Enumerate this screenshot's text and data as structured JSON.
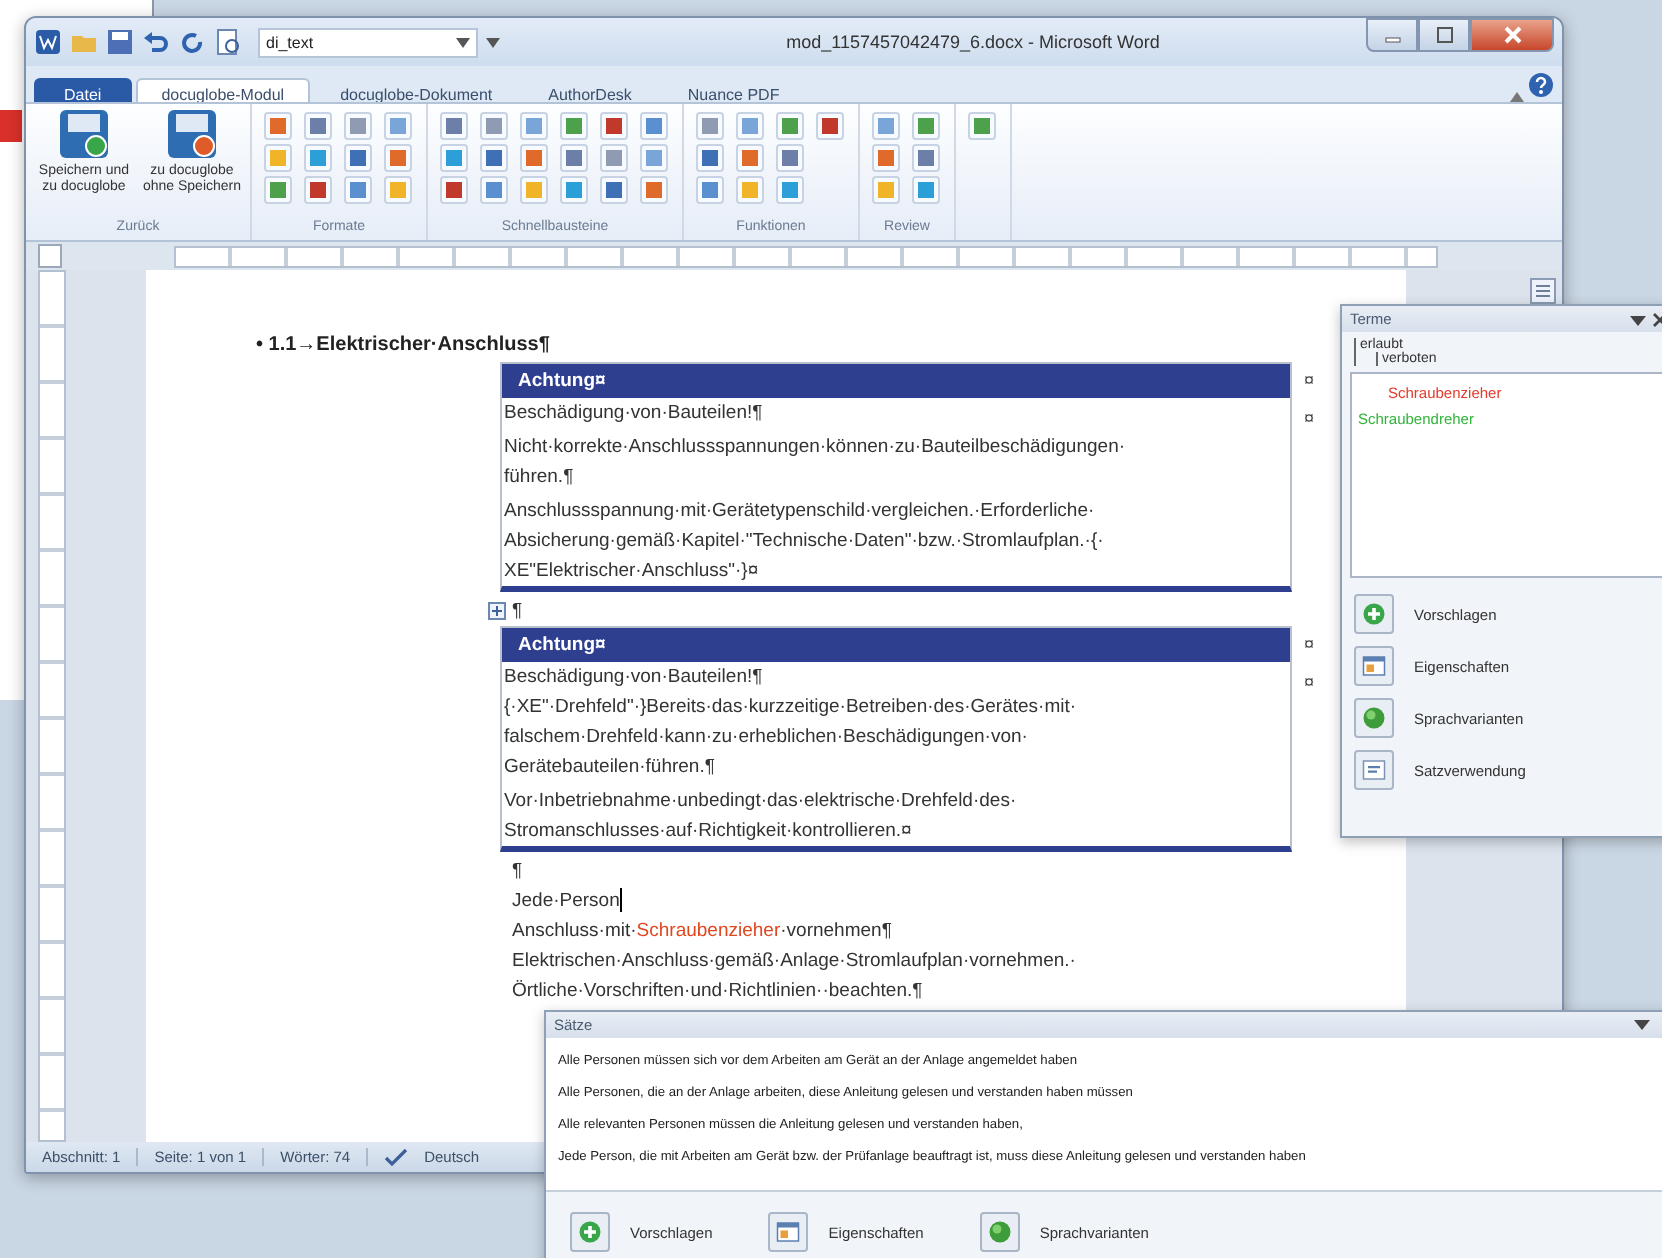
{
  "title_bar": {
    "combo": "di_text",
    "title": "mod_1157457042479_6.docx - Microsoft Word"
  },
  "tabs": [
    {
      "label": "Datei",
      "kind": "file",
      "selected": false
    },
    {
      "label": "docuglobe-Modul",
      "kind": "tab",
      "selected": true
    },
    {
      "label": "docuglobe-Dokument",
      "kind": "tab",
      "selected": false
    },
    {
      "label": "AuthorDesk",
      "kind": "tab",
      "selected": false
    },
    {
      "label": "Nuance PDF",
      "kind": "tab",
      "selected": false
    }
  ],
  "ribbon": {
    "groups": [
      {
        "label": "Zurück",
        "kind": "big",
        "buttons": [
          {
            "label": "Speichern und zu docuglobe",
            "kind": "save"
          },
          {
            "label": "zu docuglobe ohne Speichern",
            "kind": "discard"
          }
        ]
      },
      {
        "label": "Formate",
        "kind": "small"
      },
      {
        "label": "Schnellbausteine",
        "kind": "small"
      },
      {
        "label": "Funktionen",
        "kind": "small"
      },
      {
        "label": "Review",
        "kind": "small"
      },
      {
        "kind": "small"
      }
    ]
  },
  "document": {
    "blocks": [
      {
        "kind": "heading",
        "text": "• 1.1→Elektrischer·Anschluss¶"
      },
      {
        "kind": "warning",
        "header": "Achtung¤",
        "row_marks": [
          "¤",
          "¤"
        ],
        "paragraphs": [
          [
            "Beschädigung·von·Bauteilen!¶"
          ],
          [
            "Nicht·korrekte·Anschlussspannungen·können·zu·Bauteilbeschädigungen·",
            "führen.¶"
          ],
          [
            "Anschlussspannung·mit·Gerätetypenschild·vergleichen.·Erforderliche·",
            "Absicherung·gemäß·Kapitel·\"Technische·Daten\"·bzw.·Stromlaufplan.·{·",
            "XE\"Elektrischer·Anschluss\"·}¤"
          ]
        ]
      },
      {
        "kind": "table_anchor",
        "text": "¶"
      },
      {
        "kind": "warning",
        "header": "Achtung¤",
        "row_marks": [
          "¤",
          "¤"
        ],
        "paragraphs": [
          [
            "Beschädigung·von·Bauteilen!¶",
            "{·XE\"·Drehfeld\"·}Bereits·das·kurzzeitige·Betreiben·des·Gerätes·mit·",
            "falschem·Drehfeld·kann·zu·erheblichen·Beschädigungen·von·",
            "Gerätebauteilen·führen.¶"
          ],
          [
            "Vor·Inbetriebnahme·unbedingt·das·elektrische·Drehfeld·des·",
            "Stromanschlusses·auf·Richtigkeit·kontrollieren.¤"
          ]
        ]
      },
      {
        "kind": "paragraph",
        "lines": [
          "¶"
        ]
      },
      {
        "kind": "cursor_line",
        "text": "Jede·Person"
      },
      {
        "kind": "segments",
        "segments": [
          {
            "text": "Anschluss·mit·",
            "kind": "plain"
          },
          {
            "text": "Schraubenzieher",
            "kind": "forbidden"
          },
          {
            "text": "·vornehmen¶",
            "kind": "plain"
          }
        ]
      },
      {
        "kind": "paragraph",
        "lines": [
          "Elektrischen·Anschluss·gemäß·Anlage·Stromlaufplan·vornehmen.·",
          "Örtliche·Vorschriften·und·Richtlinien··beachten.¶"
        ]
      }
    ]
  },
  "status_bar": {
    "items": [
      "Abschnitt: 1",
      "Seite: 1 von 1",
      "Wörter: 74"
    ],
    "language": "Deutsch"
  },
  "terme_panel": {
    "title": "Terme",
    "legend": [
      {
        "label": "erlaubt",
        "children": [
          {
            "label": "verboten"
          }
        ]
      }
    ],
    "terms": [
      {
        "label": "Schraubenzieher",
        "kind": "forbidden"
      },
      {
        "label": "Schraubendreher",
        "kind": "allowed"
      }
    ],
    "actions": [
      {
        "label": "Vorschlagen",
        "kind": "suggest"
      },
      {
        "label": "Eigenschaften",
        "kind": "properties"
      },
      {
        "label": "Sprachvarianten",
        "kind": "variants"
      },
      {
        "label": "Satzverwendung",
        "kind": "usage"
      }
    ]
  },
  "saetze_panel": {
    "title": "Sätze",
    "sentences": [
      "Alle Personen müssen sich vor dem Arbeiten am Gerät an der Anlage angemeldet haben",
      "Alle Personen, die an der Anlage arbeiten, diese Anleitung gelesen und verstanden haben müssen",
      "Alle relevanten Personen müssen die Anleitung gelesen und verstanden haben,",
      "Jede Person, die mit Arbeiten am Gerät bzw. der Prüfanlage beauftragt ist, muss diese Anleitung gelesen und verstanden haben"
    ],
    "actions": [
      {
        "label": "Vorschlagen",
        "kind": "suggest"
      },
      {
        "label": "Eigenschaften",
        "kind": "properties"
      },
      {
        "label": "Sprachvarianten",
        "kind": "variants"
      }
    ]
  }
}
